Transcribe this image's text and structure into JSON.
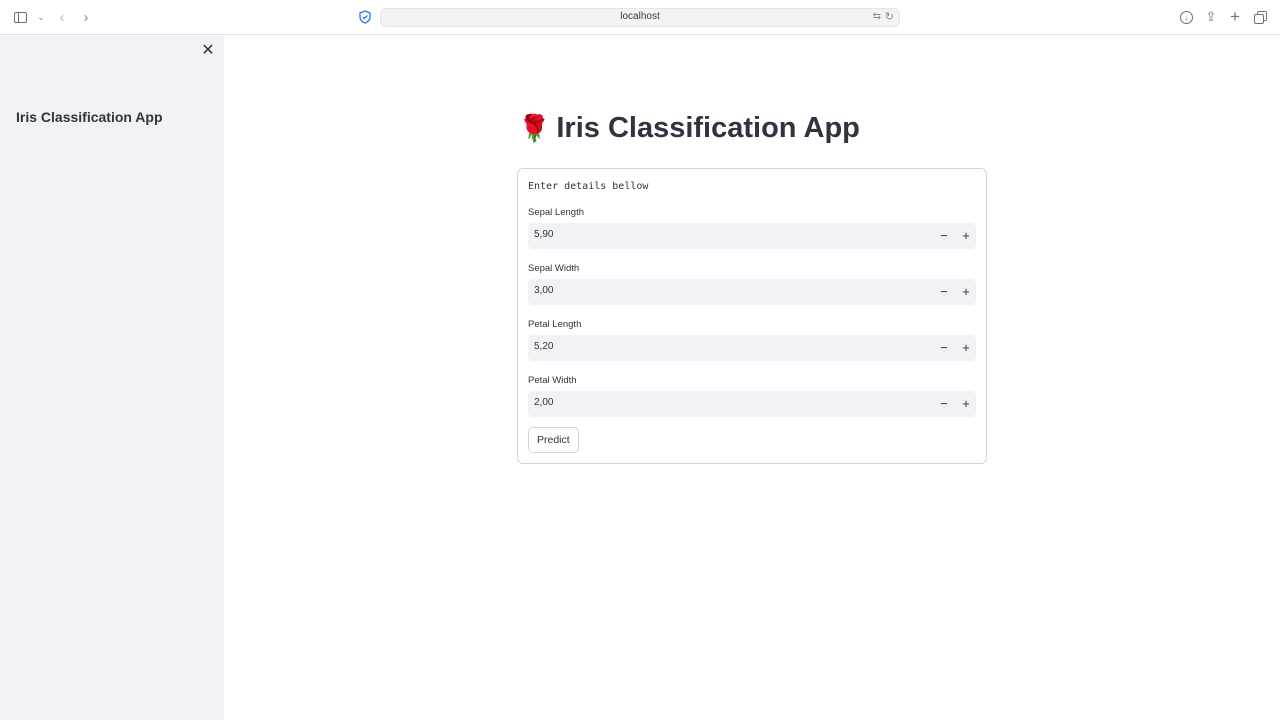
{
  "browser": {
    "url": "localhost"
  },
  "sidebar": {
    "title": "Iris Classification App",
    "close_icon": "close-icon"
  },
  "main": {
    "title_emoji": "🌹",
    "title": "Iris Classification App"
  },
  "form": {
    "intro": "Enter details bellow",
    "fields": [
      {
        "label": "Sepal Length",
        "value": "5,90"
      },
      {
        "label": "Sepal Width",
        "value": "3,00"
      },
      {
        "label": "Petal Length",
        "value": "5,20"
      },
      {
        "label": "Petal Width",
        "value": "2,00"
      }
    ],
    "minus_label": "−",
    "plus_label": "+",
    "predict_label": "Predict"
  }
}
